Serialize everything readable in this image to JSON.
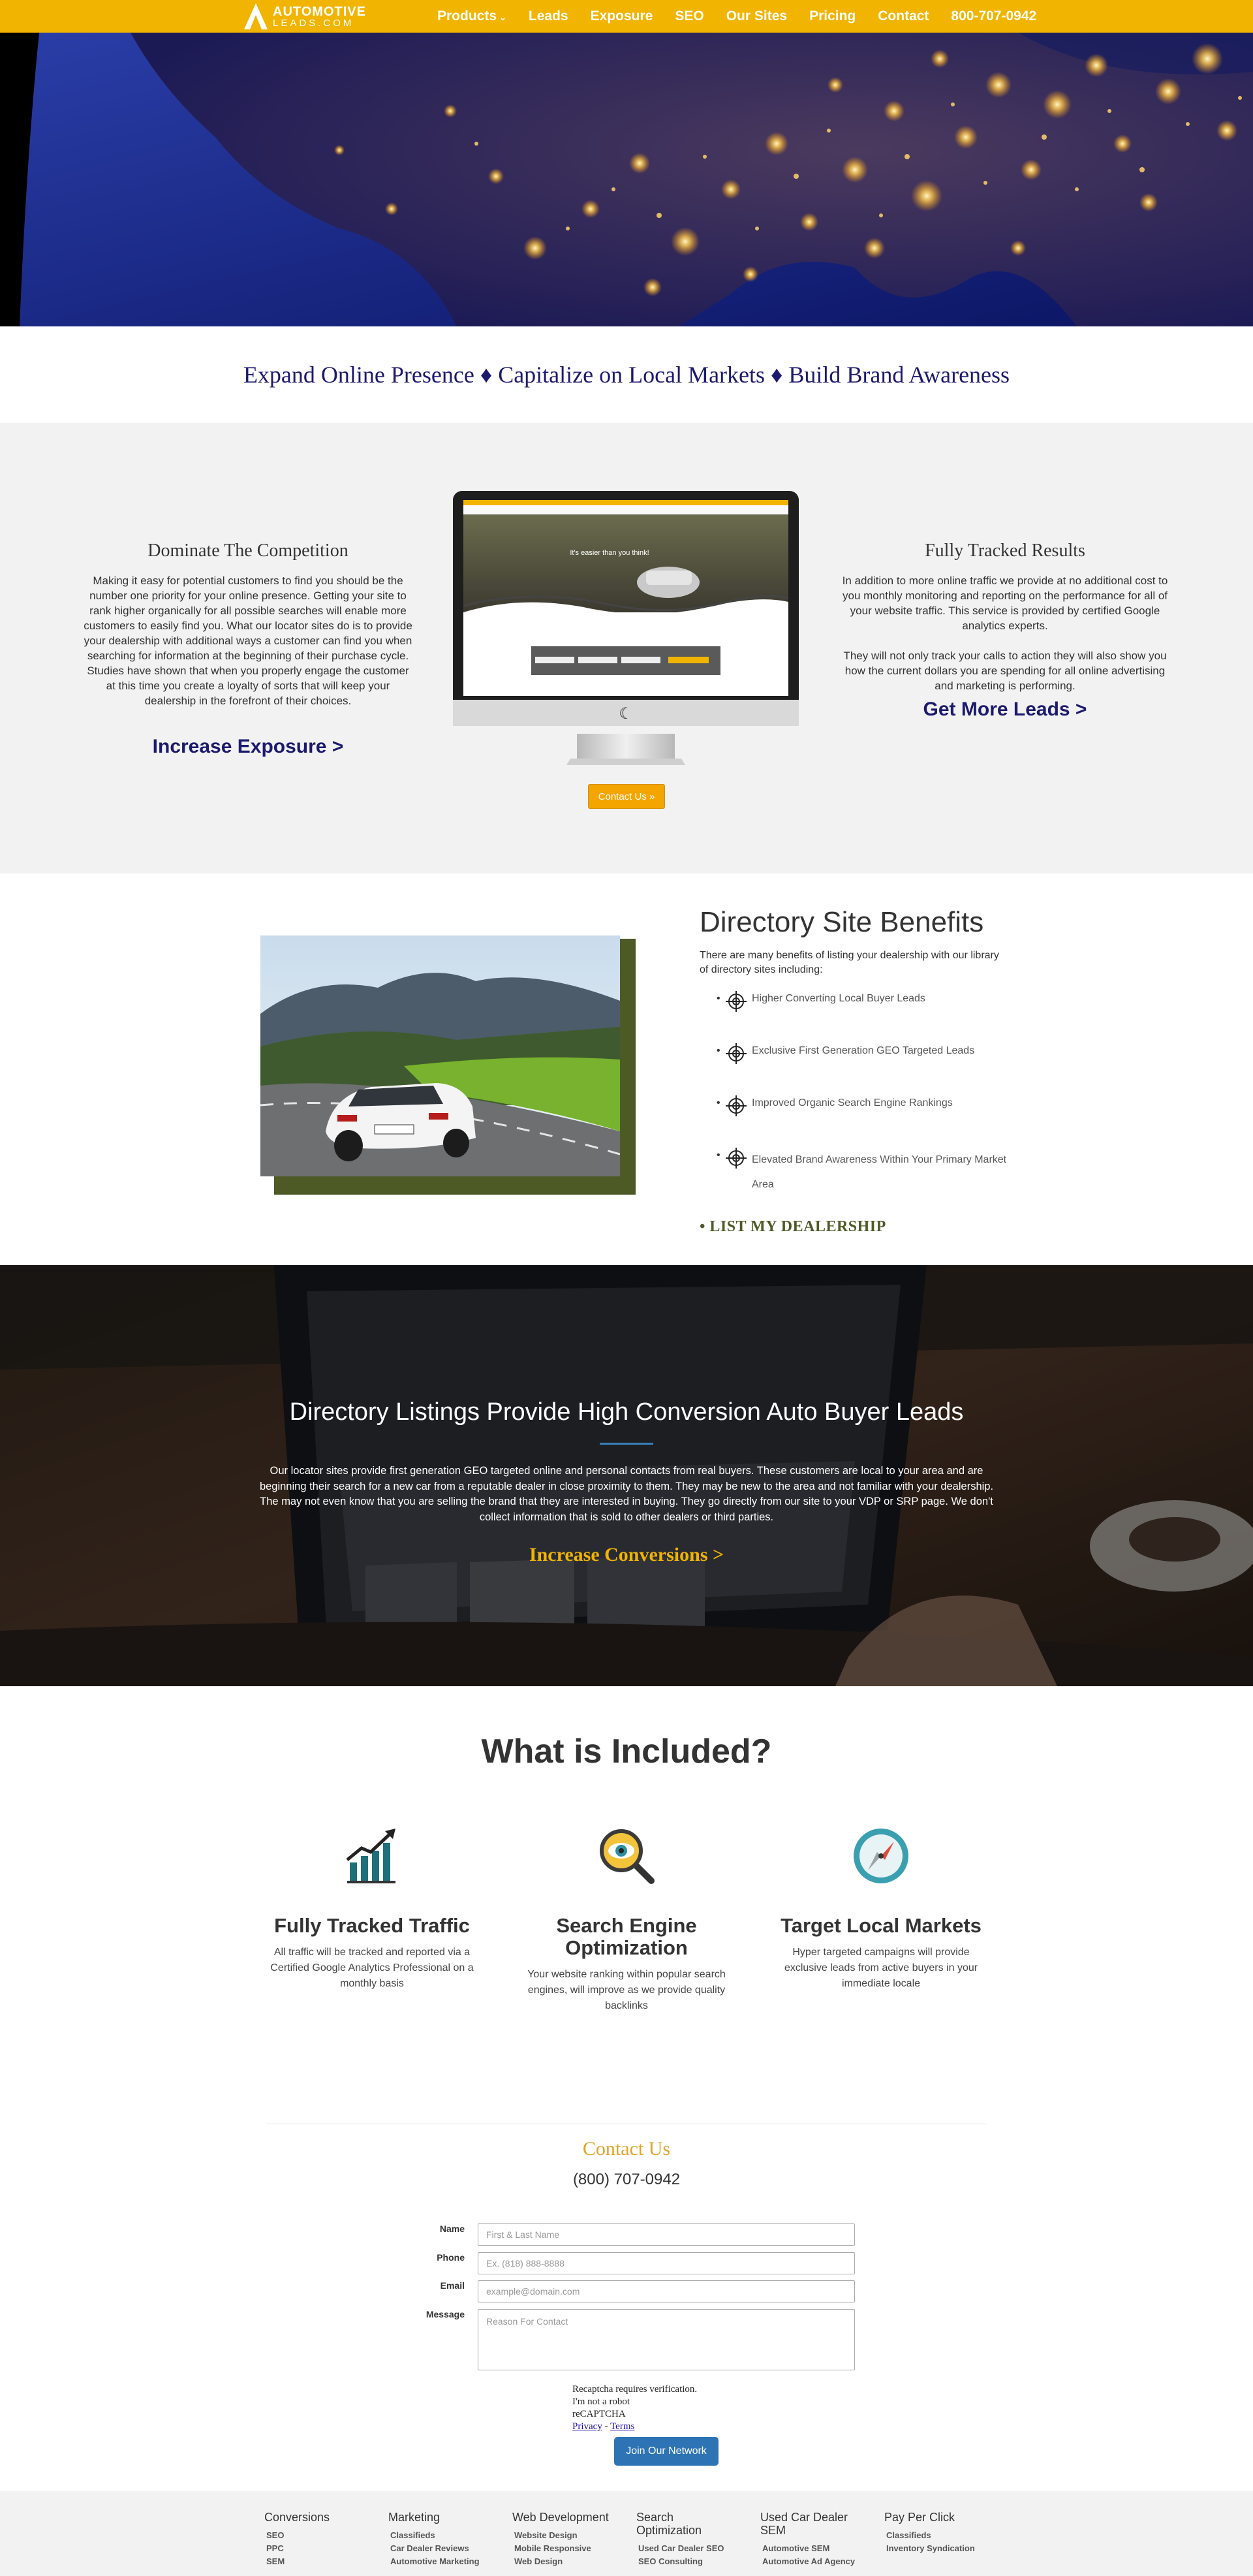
{
  "nav": {
    "logo_line1": "AUTOMOTIVE",
    "logo_line2": "LEADS.COM",
    "items": [
      {
        "label": "Products",
        "caret": "⌄"
      },
      {
        "label": "Leads"
      },
      {
        "label": "Exposure"
      },
      {
        "label": "SEO"
      },
      {
        "label": "Our Sites"
      },
      {
        "label": "Pricing"
      },
      {
        "label": "Contact"
      },
      {
        "label": "800-707-0942"
      }
    ]
  },
  "tagline": "Expand Online Presence ♦ Capitalize on Local Markets ♦ Build Brand Awareness",
  "compete": {
    "title": "Dominate The Competition",
    "text": "Making it easy for potential customers to find you should be the number one priority for your online presence. Getting your site to rank higher organically for all possible searches will enable more customers to easily find you. What our locator sites do is to provide your dealership with additional ways a customer can find you when searching for information at the beginning of their purchase cycle. Studies have shown that when you properly engage the customer at this time you create a loyalty of sorts that will keep your dealership in the forefront of their choices.",
    "link": "Increase Exposure >"
  },
  "screen": {
    "headline": "It's easier than you think!",
    "button": "Contact Us »"
  },
  "tracked": {
    "title": "Fully Tracked Results",
    "text1": "In addition to more online traffic we provide at no additional cost to you monthly monitoring and reporting on the performance for all of your website traffic. This service is provided by certified Google analytics experts.",
    "text2": "They will not only track your calls to action they will also show you how the current dollars you are spending for all online advertising and marketing is performing.",
    "link": "Get More Leads >"
  },
  "directory": {
    "title": "Directory Site Benefits",
    "intro": "There are many benefits of listing your dealership with our library of directory sites including:",
    "benefits": [
      "Higher Converting Local Buyer Leads",
      "Exclusive First Generation GEO Targeted Leads",
      "Improved Organic Search Engine Rankings",
      "Elevated Brand Awareness Within Your Primary Market Area"
    ],
    "cta": "• LIST MY DEALERSHIP"
  },
  "conversion": {
    "title": "Directory Listings Provide High Conversion Auto Buyer Leads",
    "text": "Our locator sites provide first generation GEO targeted online and personal contacts from real buyers. These customers are local to your area and are beginning their search for a new car from a reputable dealer in close proximity to them. They may be new to the area and not familiar with your dealership. The may not even know that you are selling the brand that they are interested in buying. They go directly from our site to your VDP or SRP page. We don't collect information that is sold to other dealers or third parties.",
    "link": "Increase Conversions >"
  },
  "included": {
    "title": "What is Included?",
    "features": [
      {
        "icon": "bar-chart-icon",
        "title": "Fully Tracked Traffic",
        "text": "All traffic will be tracked and reported via a Certified Google Analytics Professional on a monthly basis"
      },
      {
        "icon": "magnifier-eye-icon",
        "title": "Search Engine Optimization",
        "text": "Your website ranking within popular search engines, will improve as we provide quality backlinks"
      },
      {
        "icon": "compass-icon",
        "title": "Target Local Markets",
        "text": "Hyper targeted campaigns will provide exclusive leads from active buyers in your immediate locale"
      }
    ]
  },
  "contact": {
    "title": "Contact Us",
    "phone": "(800) 707-0942",
    "fields": {
      "name_label": "Name",
      "name_placeholder": "First & Last Name",
      "phone_label": "Phone",
      "phone_placeholder": "Ex. (818) 888-8888",
      "email_label": "Email",
      "email_placeholder": "example@domain.com",
      "message_label": "Message",
      "message_placeholder": "Reason For Contact"
    },
    "captcha": {
      "line1": "Recaptcha requires verification.",
      "line2": "I'm not a robot",
      "line3": "reCAPTCHA",
      "privacy": "Privacy",
      "sep": " - ",
      "terms": "Terms"
    },
    "submit": "Join Our Network"
  },
  "footer": {
    "columns": [
      {
        "head": "Conversions",
        "items": [
          "SEO",
          "PPC",
          "SEM"
        ]
      },
      {
        "head": "Marketing",
        "items": [
          "Classifieds",
          "Car Dealer Reviews",
          "Automotive Marketing"
        ]
      },
      {
        "head": "Web Development",
        "items": [
          "Website Design",
          "Mobile Responsive",
          "Web Design"
        ]
      },
      {
        "head": "Search Optimization",
        "items": [
          "Used Car Dealer SEO",
          "SEO Consulting"
        ]
      },
      {
        "head": "Used Car Dealer SEM",
        "items": [
          "Automotive SEM",
          "Automotive Ad Agency"
        ]
      },
      {
        "head": "Pay Per Click",
        "items": [
          "Classifieds",
          "Inventory Syndication"
        ]
      }
    ]
  },
  "colors": {
    "brand_yellow": "#f1b400",
    "navy": "#1c1a6e",
    "olive": "#4e5a26",
    "button_blue": "#2e74b5"
  }
}
